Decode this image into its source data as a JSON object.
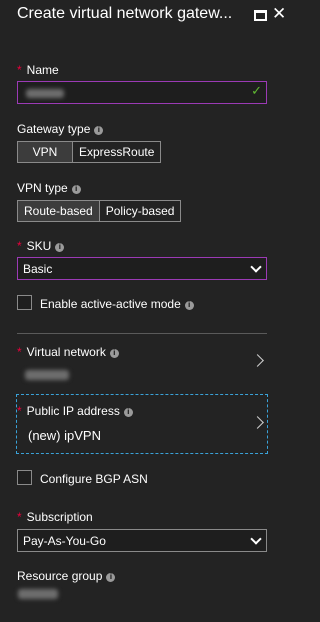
{
  "header": {
    "title": "Create virtual network gatew..."
  },
  "name_field": {
    "label": "Name",
    "required": "*"
  },
  "gateway_type": {
    "label": "Gateway type",
    "options": [
      "VPN",
      "ExpressRoute"
    ],
    "selected": "VPN"
  },
  "vpn_type": {
    "label": "VPN type",
    "options": [
      "Route-based",
      "Policy-based"
    ],
    "selected": "Route-based"
  },
  "sku": {
    "label": "SKU",
    "required": "*",
    "value": "Basic"
  },
  "active_active": {
    "label": "Enable active-active mode",
    "checked": false
  },
  "virtual_network": {
    "label": "Virtual network",
    "required": "*"
  },
  "public_ip": {
    "label": "Public IP address",
    "required": "*",
    "value": "(new) ipVPN"
  },
  "bgp": {
    "label": "Configure BGP ASN",
    "checked": false
  },
  "subscription": {
    "label": "Subscription",
    "required": "*",
    "value": "Pay-As-You-Go"
  },
  "resource_group": {
    "label": "Resource group"
  },
  "colors": {
    "background": "#232323",
    "required": "#e8003c",
    "focus_border": "#9b3ab5",
    "valid": "#5fb832",
    "selected_border": "#3aa2d8"
  }
}
